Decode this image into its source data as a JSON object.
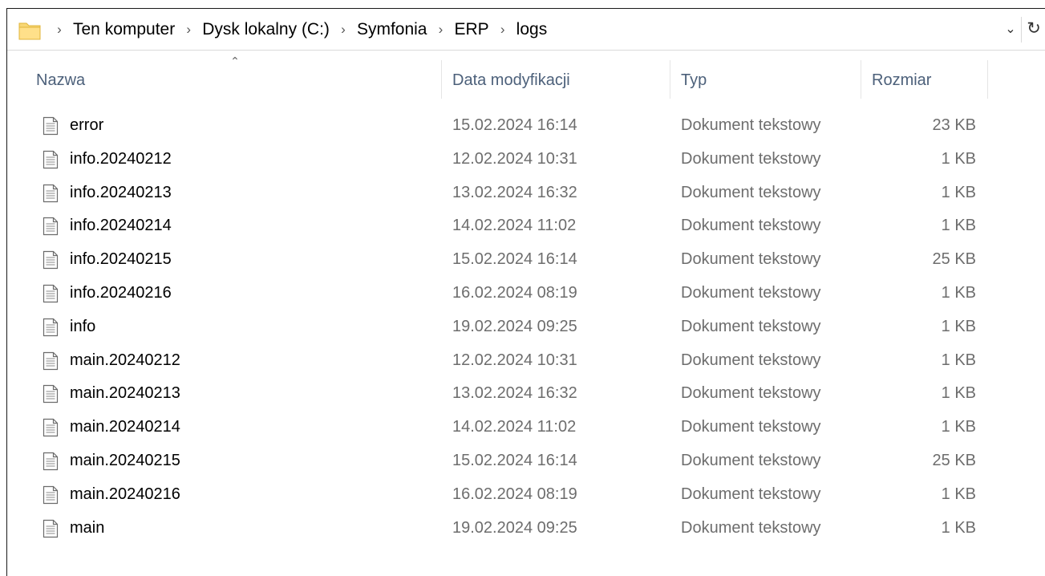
{
  "address_bar": {
    "folder_icon": "folder-icon",
    "breadcrumbs": [
      "Ten komputer",
      "Dysk lokalny (C:)",
      "Symfonia",
      "ERP",
      "logs"
    ],
    "separator_icon": "chevron-right-icon",
    "dropdown_icon": "chevron-down-icon",
    "refresh_icon": "refresh-icon"
  },
  "columns": {
    "name": "Nazwa",
    "date": "Data modyfikacji",
    "type": "Typ",
    "size": "Rozmiar",
    "sort_icon": "sort-ascending-icon"
  },
  "files": [
    {
      "name": "error",
      "date": "15.02.2024 16:14",
      "type": "Dokument tekstowy",
      "size": "23 KB"
    },
    {
      "name": "info.20240212",
      "date": "12.02.2024 10:31",
      "type": "Dokument tekstowy",
      "size": "1 KB"
    },
    {
      "name": "info.20240213",
      "date": "13.02.2024 16:32",
      "type": "Dokument tekstowy",
      "size": "1 KB"
    },
    {
      "name": "info.20240214",
      "date": "14.02.2024 11:02",
      "type": "Dokument tekstowy",
      "size": "1 KB"
    },
    {
      "name": "info.20240215",
      "date": "15.02.2024 16:14",
      "type": "Dokument tekstowy",
      "size": "25 KB"
    },
    {
      "name": "info.20240216",
      "date": "16.02.2024 08:19",
      "type": "Dokument tekstowy",
      "size": "1 KB"
    },
    {
      "name": "info",
      "date": "19.02.2024 09:25",
      "type": "Dokument tekstowy",
      "size": "1 KB"
    },
    {
      "name": "main.20240212",
      "date": "12.02.2024 10:31",
      "type": "Dokument tekstowy",
      "size": "1 KB"
    },
    {
      "name": "main.20240213",
      "date": "13.02.2024 16:32",
      "type": "Dokument tekstowy",
      "size": "1 KB"
    },
    {
      "name": "main.20240214",
      "date": "14.02.2024 11:02",
      "type": "Dokument tekstowy",
      "size": "1 KB"
    },
    {
      "name": "main.20240215",
      "date": "15.02.2024 16:14",
      "type": "Dokument tekstowy",
      "size": "25 KB"
    },
    {
      "name": "main.20240216",
      "date": "16.02.2024 08:19",
      "type": "Dokument tekstowy",
      "size": "1 KB"
    },
    {
      "name": "main",
      "date": "19.02.2024 09:25",
      "type": "Dokument tekstowy",
      "size": "1 KB"
    }
  ],
  "file_icon": "text-document-icon",
  "colors": {
    "header_text": "#4c607a",
    "secondary_text": "#6d6d6d",
    "folder_yellow": "#f4c542"
  }
}
